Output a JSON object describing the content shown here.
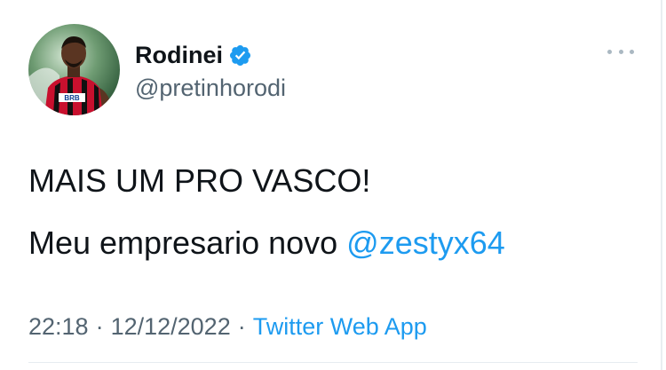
{
  "user": {
    "display_name": "Rodinei",
    "handle": "@pretinhorodi",
    "verified": true
  },
  "tweet": {
    "line1": "MAIS UM PRO VASCO!",
    "line2_text": "Meu empresario novo ",
    "mention": "@zestyx64"
  },
  "meta": {
    "time": "22:18",
    "separator": "·",
    "date": "12/12/2022",
    "source": "Twitter Web App"
  },
  "avatar_jersey_text": "BRB",
  "icons": {
    "verified": "verified-badge-icon",
    "more": "more-options-icon"
  },
  "colors": {
    "accent": "#1d9bf0",
    "secondary_text": "#536471",
    "primary_text": "#0f1419"
  }
}
